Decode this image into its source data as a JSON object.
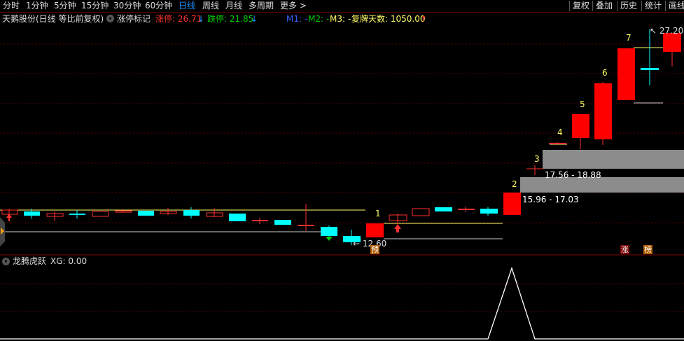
{
  "toolbar": {
    "periods": [
      "分时",
      "1分钟",
      "5分钟",
      "15分钟",
      "30分钟",
      "60分钟",
      "日线",
      "周线",
      "月线",
      "多周期",
      "更多 >"
    ],
    "active": "日线",
    "right_buttons": [
      "复权",
      "叠加",
      "历史",
      "统计",
      "画线"
    ]
  },
  "info": {
    "stock": "天鹅股份(日线 等比前复权)",
    "indicator": "涨停标记",
    "limit_up": "涨停: 26.71",
    "limit_down": "跌停: 21.85",
    "m1": "M1: -",
    "m2": "M2: -",
    "m3": "M3: -",
    "resume_days": "复牌天数: 1050.00"
  },
  "colors": {
    "up": "#ff0000",
    "down": "#00ffff",
    "grid": "#5a0000",
    "yellow": "#ffff66"
  },
  "chart_annotations": {
    "numbers": [
      "1",
      "2",
      "3",
      "4",
      "5",
      "6",
      "7"
    ],
    "low_label": "12.60",
    "high_label": "27.20",
    "zone_2": "15.96 - 17.03",
    "zone_3": "17.56 - 18.88",
    "badge_yu": "预",
    "badge_zhang": "涨",
    "badge_bang": "榜"
  },
  "sub": {
    "title": "龙腾虎跃",
    "xg": "XG: 0.00"
  }
}
